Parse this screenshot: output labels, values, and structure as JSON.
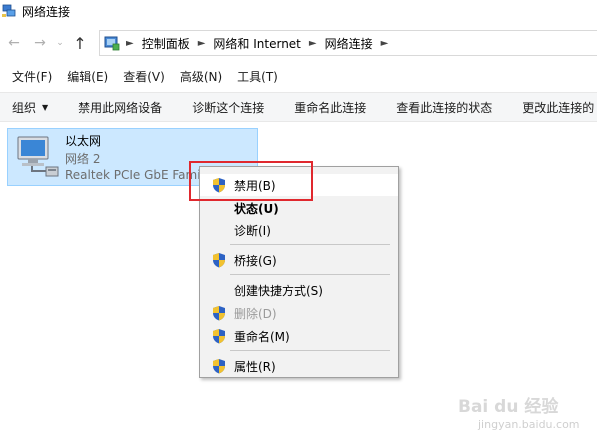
{
  "window": {
    "title": "网络连接"
  },
  "address": {
    "crumbs": [
      "控制面板",
      "网络和 Internet",
      "网络连接"
    ]
  },
  "menubar": {
    "items": [
      "文件(F)",
      "编辑(E)",
      "查看(V)",
      "高级(N)",
      "工具(T)"
    ]
  },
  "toolbar": {
    "items": [
      "组织",
      "禁用此网络设备",
      "诊断这个连接",
      "重命名此连接",
      "查看此连接的状态",
      "更改此连接的"
    ]
  },
  "adapter": {
    "name": "以太网",
    "network": "网络 2",
    "device": "Realtek PCIe GbE Family"
  },
  "context_menu": {
    "items": [
      {
        "label": "禁用(B)",
        "shield": true,
        "style": "hover"
      },
      {
        "label": "状态(U)",
        "shield": false,
        "style": "bold"
      },
      {
        "label": "诊断(I)",
        "shield": false,
        "style": "normal"
      },
      {
        "label": "桥接(G)",
        "shield": true,
        "style": "normal"
      },
      {
        "label": "创建快捷方式(S)",
        "shield": false,
        "style": "normal"
      },
      {
        "label": "删除(D)",
        "shield": true,
        "style": "disabled"
      },
      {
        "label": "重命名(M)",
        "shield": true,
        "style": "normal"
      },
      {
        "label": "属性(R)",
        "shield": true,
        "style": "normal"
      }
    ]
  },
  "watermark": {
    "text": "Bai du 经验",
    "sub": "jingyan.baidu.com"
  },
  "colors": {
    "selection_bg": "#cce8ff",
    "highlight_box": "#e0282e",
    "menu_bg": "#f2f2f2"
  }
}
